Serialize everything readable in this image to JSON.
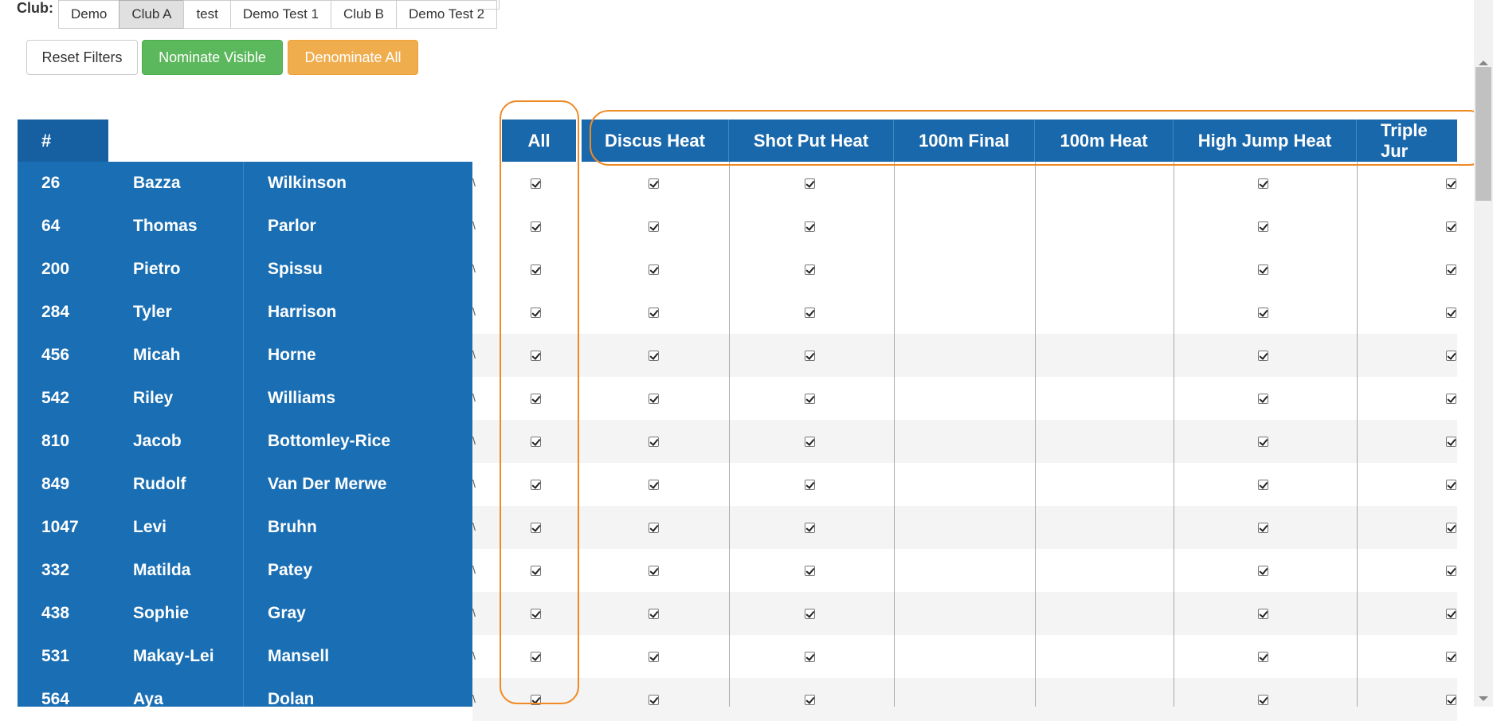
{
  "filters": {
    "club_label": "Club:",
    "club_options": [
      "Demo",
      "Club A",
      "test",
      "Demo Test 1",
      "Club B",
      "Demo Test 2"
    ],
    "selected_club": "Club A"
  },
  "actions": {
    "reset_label": "Reset Filters",
    "nominate_label": "Nominate Visible",
    "denominate_label": "Denominate All"
  },
  "table": {
    "header_number": "#",
    "header_all": "All",
    "events": [
      "Discus Heat",
      "Shot Put Heat",
      "100m Final",
      "100m Heat",
      "High Jump Heat",
      "Triple Jur"
    ],
    "rows": [
      {
        "number": "26",
        "first": "Bazza",
        "last": "Wilkinson"
      },
      {
        "number": "64",
        "first": "Thomas",
        "last": "Parlor"
      },
      {
        "number": "200",
        "first": "Pietro",
        "last": "Spissu"
      },
      {
        "number": "284",
        "first": "Tyler",
        "last": "Harrison"
      },
      {
        "number": "456",
        "first": "Micah",
        "last": "Horne"
      },
      {
        "number": "542",
        "first": "Riley",
        "last": "Williams"
      },
      {
        "number": "810",
        "first": "Jacob",
        "last": "Bottomley-Rice"
      },
      {
        "number": "849",
        "first": "Rudolf",
        "last": "Van Der Merwe"
      },
      {
        "number": "1047",
        "first": "Levi",
        "last": "Bruhn"
      },
      {
        "number": "332",
        "first": "Matilda",
        "last": "Patey"
      },
      {
        "number": "438",
        "first": "Sophie",
        "last": "Gray"
      },
      {
        "number": "531",
        "first": "Makay-Lei",
        "last": "Mansell"
      },
      {
        "number": "564",
        "first": "Aya",
        "last": "Dolan"
      }
    ],
    "checked_events": [
      "All",
      "Discus Heat",
      "Shot Put Heat",
      "High Jump Heat",
      "Triple Jur"
    ]
  },
  "colors": {
    "header_blue": "#1a68ac",
    "frozen_blue": "#1a6eb3",
    "highlight_orange": "#f08a24",
    "nominate_green": "#5cb85c",
    "denominate_orange": "#f0ad4e"
  }
}
